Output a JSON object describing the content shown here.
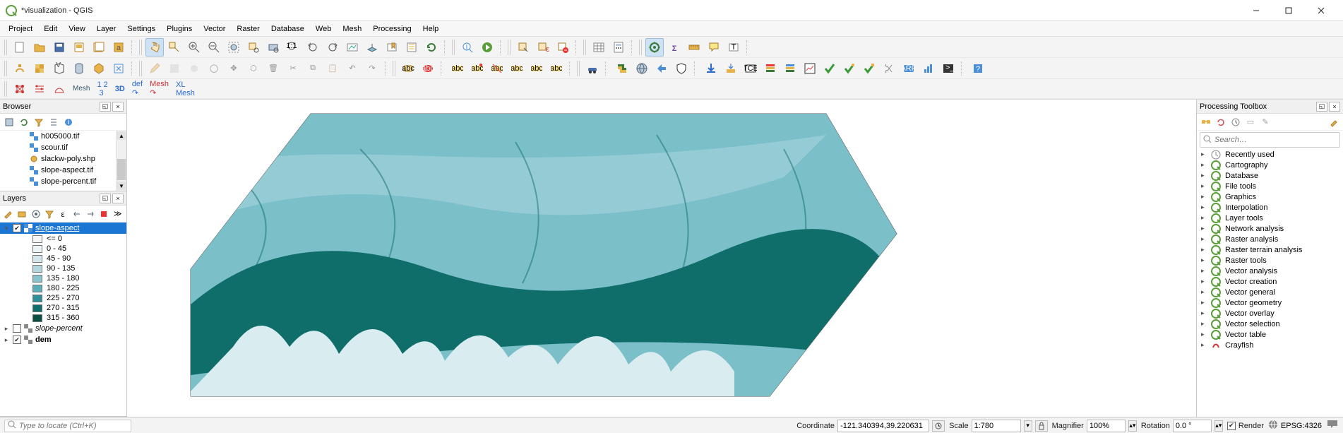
{
  "window": {
    "title": "*visualization - QGIS"
  },
  "menus": [
    "Project",
    "Edit",
    "View",
    "Layer",
    "Settings",
    "Plugins",
    "Vector",
    "Raster",
    "Database",
    "Web",
    "Mesh",
    "Processing",
    "Help"
  ],
  "browser": {
    "title": "Browser",
    "items": [
      {
        "name": "h005000.tif",
        "icon": "raster"
      },
      {
        "name": "scour.tif",
        "icon": "raster"
      },
      {
        "name": "slackw-poly.shp",
        "icon": "vector"
      },
      {
        "name": "slope-aspect.tif",
        "icon": "raster"
      },
      {
        "name": "slope-percent.tif",
        "icon": "raster"
      }
    ]
  },
  "layers": {
    "title": "Layers",
    "active": {
      "name": "slope-aspect",
      "checked": true,
      "expanded": true
    },
    "legend": [
      {
        "label": "<= 0",
        "color": "#f5f5f5"
      },
      {
        "label": "0 - 45",
        "color": "#ecf3f6"
      },
      {
        "label": "45 - 90",
        "color": "#d2e6ec"
      },
      {
        "label": "90 - 135",
        "color": "#b3d7e0"
      },
      {
        "label": "135 - 180",
        "color": "#86c3cd"
      },
      {
        "label": "180 - 225",
        "color": "#59adb9"
      },
      {
        "label": "225 - 270",
        "color": "#2f8f99"
      },
      {
        "label": "270 - 315",
        "color": "#0f6e6a"
      },
      {
        "label": "315 - 360",
        "color": "#0a4f42"
      }
    ],
    "others": [
      {
        "name": "slope-percent",
        "checked": false,
        "italic": true
      },
      {
        "name": "dem",
        "checked": true,
        "bold": true
      }
    ]
  },
  "toolbox": {
    "title": "Processing Toolbox",
    "search_placeholder": "Search…",
    "groups": [
      {
        "name": "Recently used",
        "icon": "clock"
      },
      {
        "name": "Cartography",
        "icon": "q"
      },
      {
        "name": "Database",
        "icon": "q"
      },
      {
        "name": "File tools",
        "icon": "q"
      },
      {
        "name": "Graphics",
        "icon": "q"
      },
      {
        "name": "Interpolation",
        "icon": "q"
      },
      {
        "name": "Layer tools",
        "icon": "q"
      },
      {
        "name": "Network analysis",
        "icon": "q"
      },
      {
        "name": "Raster analysis",
        "icon": "q"
      },
      {
        "name": "Raster terrain analysis",
        "icon": "q"
      },
      {
        "name": "Raster tools",
        "icon": "q"
      },
      {
        "name": "Vector analysis",
        "icon": "q"
      },
      {
        "name": "Vector creation",
        "icon": "q"
      },
      {
        "name": "Vector general",
        "icon": "q"
      },
      {
        "name": "Vector geometry",
        "icon": "q"
      },
      {
        "name": "Vector overlay",
        "icon": "q"
      },
      {
        "name": "Vector selection",
        "icon": "q"
      },
      {
        "name": "Vector table",
        "icon": "q"
      },
      {
        "name": "Crayfish",
        "icon": "cray"
      }
    ]
  },
  "status": {
    "locate_placeholder": "Type to locate (Ctrl+K)",
    "coord_label": "Coordinate",
    "coord_value": "-121.340394,39.220631",
    "scale_label": "Scale",
    "scale_value": "1:780",
    "magnifier_label": "Magnifier",
    "magnifier_value": "100%",
    "rotation_label": "Rotation",
    "rotation_value": "0.0 °",
    "render_label": "Render",
    "crs": "EPSG:4326"
  }
}
